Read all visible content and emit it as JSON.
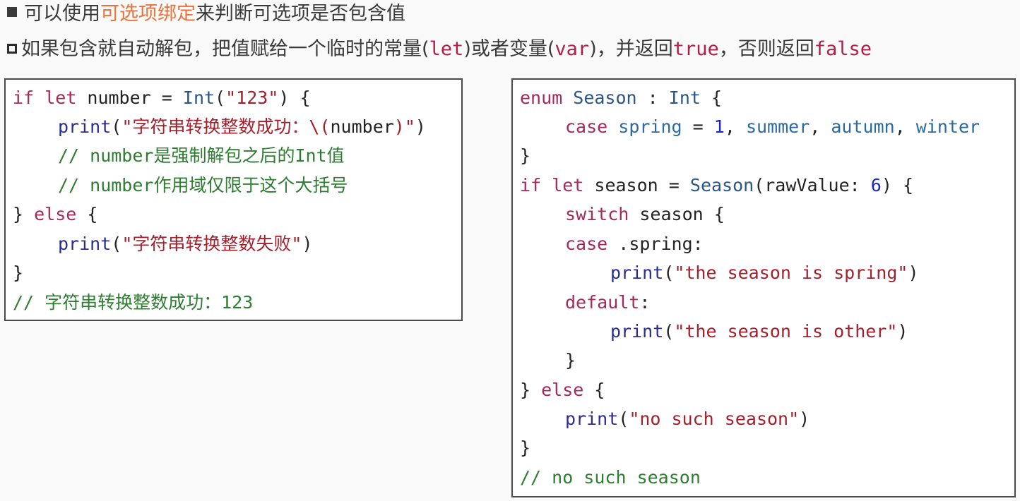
{
  "header": {
    "line1_prefix": "可以使用",
    "line1_highlight": "可选项绑定",
    "line1_suffix": "来判断可选项是否包含值",
    "line2_part1": "如果包含就自动解包，把值赋给一个临时的常量(",
    "line2_let": "let",
    "line2_part2": ")或者变量(",
    "line2_var": "var",
    "line2_part3": ")，并返回",
    "line2_true": "true",
    "line2_part4": "，否则返回",
    "line2_false": "false",
    "highlight_color": "#e8743b"
  },
  "left_code": {
    "l1": {
      "kw1": "if",
      "kw2": "let",
      "name": "number",
      "eq": "=",
      "type": "Int",
      "open": "(",
      "str": "\"123\"",
      "close": ") {"
    },
    "l2": {
      "fn": "print",
      "open": "(",
      "str1": "\"字符串转换整数成功：\\(",
      "var": "number",
      "str2": ")\"",
      "close": ")"
    },
    "l3": "// number是强制解包之后的Int值",
    "l4": "// number作用域仅限于这个大括号",
    "l5": {
      "brace": "}",
      "kw": "else",
      "open": "{"
    },
    "l6": {
      "fn": "print",
      "open": "(",
      "str": "\"字符串转换整数失败\"",
      "close": ")"
    },
    "l7": "}",
    "l8": "// 字符串转换整数成功：123"
  },
  "right_code": {
    "r1": {
      "kw": "enum",
      "type": "Season",
      "colon": ":",
      "raw": "Int",
      "open": "{"
    },
    "r2": {
      "kw": "case",
      "c1": "spring",
      "eq": "=",
      "num": "1",
      "c2": "summer",
      "c3": "autumn",
      "c4": "winter"
    },
    "r3": "}",
    "r4": {
      "kw1": "if",
      "kw2": "let",
      "name": "season",
      "eq": "=",
      "type": "Season",
      "arg": "(rawValue: ",
      "num": "6",
      "close": ") {"
    },
    "r5": {
      "kw": "switch",
      "name": "season",
      "open": "{"
    },
    "r6": {
      "kw": "case",
      "val": ".spring:"
    },
    "r7": {
      "fn": "print",
      "open": "(",
      "str": "\"the season is spring\"",
      "close": ")"
    },
    "r8": {
      "kw": "default",
      "colon": ":"
    },
    "r9": {
      "fn": "print",
      "open": "(",
      "str": "\"the season is other\"",
      "close": ")"
    },
    "r10": "}",
    "r11": {
      "brace": "}",
      "kw": "else",
      "open": "{"
    },
    "r12": {
      "fn": "print",
      "open": "(",
      "str": "\"no such season\"",
      "close": ")"
    },
    "r13": "}",
    "r14": "// no such season"
  }
}
